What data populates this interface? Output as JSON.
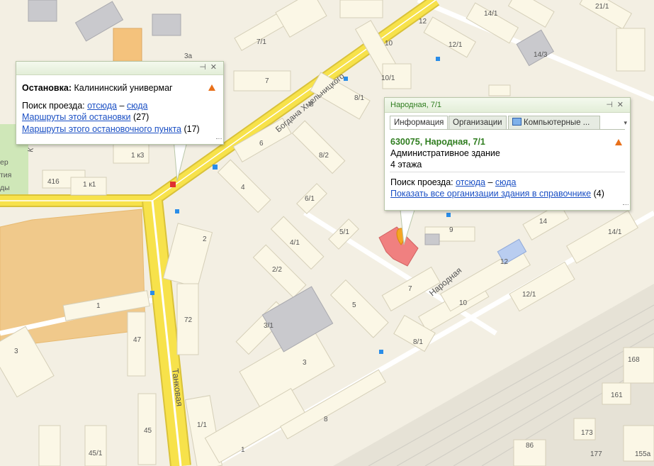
{
  "stop_popup": {
    "label": "Остановка:",
    "name": "Калининский универмаг",
    "route_search_label": "Поиск проезда:",
    "from_here": "отсюда",
    "dash": "–",
    "to_here": "сюда",
    "routes_stop_link": "Маршруты этой остановки",
    "routes_stop_count": "(27)",
    "routes_point_link": "Маршруты этого остановочного пункта",
    "routes_point_count": "(17)"
  },
  "building_popup": {
    "title": "Народная, 7/1",
    "tabs": [
      "Информация",
      "Организации",
      "Компьютерные ..."
    ],
    "address": "630075, Народная, 7/1",
    "type": "Административное здание",
    "floors": "4 этажа",
    "route_search_label": "Поиск проезда:",
    "from_here": "отсюда",
    "dash": "–",
    "to_here": "сюда",
    "show_orgs_link": "Показать все организации здания в справочнике",
    "show_orgs_count": "(4)"
  },
  "streets": {
    "khmelnitsky": "Богдана Хмельницкого",
    "narodnaya": "Народная",
    "tankovaya": "Танковая"
  },
  "building_numbers": [
    "7/1",
    "3а",
    "7",
    "8",
    "8/1",
    "10",
    "10/1",
    "12",
    "12/1",
    "14/1",
    "14/3",
    "21/1",
    "6",
    "8/2",
    "4",
    "6/1",
    "5/1",
    "9",
    "14",
    "14/1",
    "4/1",
    "2/2",
    "5",
    "7",
    "12",
    "12/1",
    "2",
    "72",
    "3/1",
    "3",
    "1",
    "47",
    "8/1",
    "10",
    "168",
    "161",
    "8",
    "1/1",
    "1",
    "45",
    "45/1",
    "173",
    "177",
    "155а",
    "86",
    "416",
    "1 к1",
    "1 к3",
    "3"
  ],
  "partial_labels": [
    "ер",
    "тия",
    "ды",
    "К"
  ],
  "colors": {
    "background": "#f3efe3",
    "building": "#fbf7e6",
    "main_road": "#f7e24b",
    "selected_building": "#f08080",
    "link": "#1a4fc4",
    "title_green": "#2f7d1f"
  }
}
